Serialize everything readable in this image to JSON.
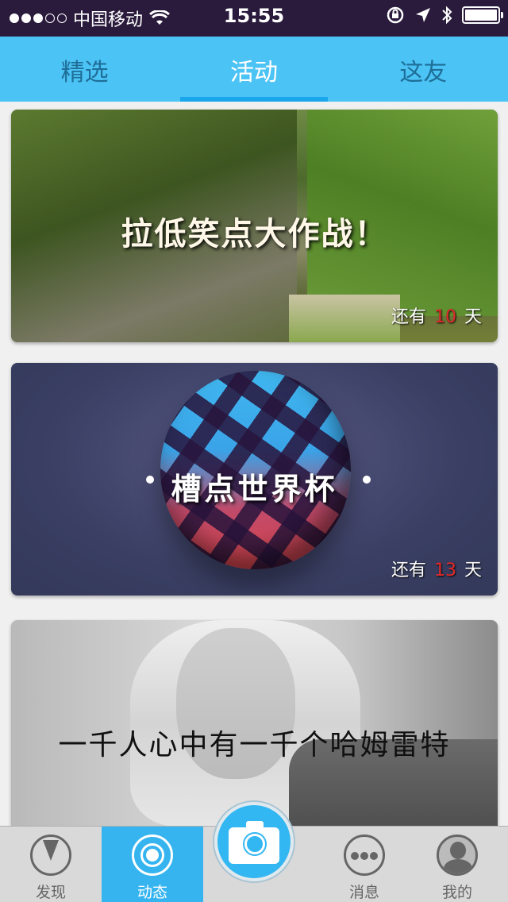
{
  "status_bar": {
    "carrier": "中国移动",
    "time": "15:55"
  },
  "top_tabs": [
    {
      "label": "精选",
      "active": false
    },
    {
      "label": "活动",
      "active": true
    },
    {
      "label": "这友",
      "active": false
    }
  ],
  "cards": [
    {
      "title": "拉低笑点大作战！",
      "countdown_prefix": "还有",
      "days": "10",
      "countdown_suffix": "天"
    },
    {
      "title": "槽点世界杯",
      "countdown_prefix": "还有",
      "days": "13",
      "countdown_suffix": "天"
    },
    {
      "title": "一千人心中有一千个哈姆雷特"
    }
  ],
  "bottom_tabs": [
    {
      "label": "发现",
      "icon": "compass-icon"
    },
    {
      "label": "动态",
      "icon": "target-icon",
      "active": true
    },
    {
      "label": "消息",
      "icon": "chat-dots-icon"
    },
    {
      "label": "我的",
      "icon": "person-icon"
    }
  ],
  "colors": {
    "accent": "#4cc3f5",
    "highlight_number": "#e32a2a",
    "status_bar_bg": "#2a1b3d"
  }
}
